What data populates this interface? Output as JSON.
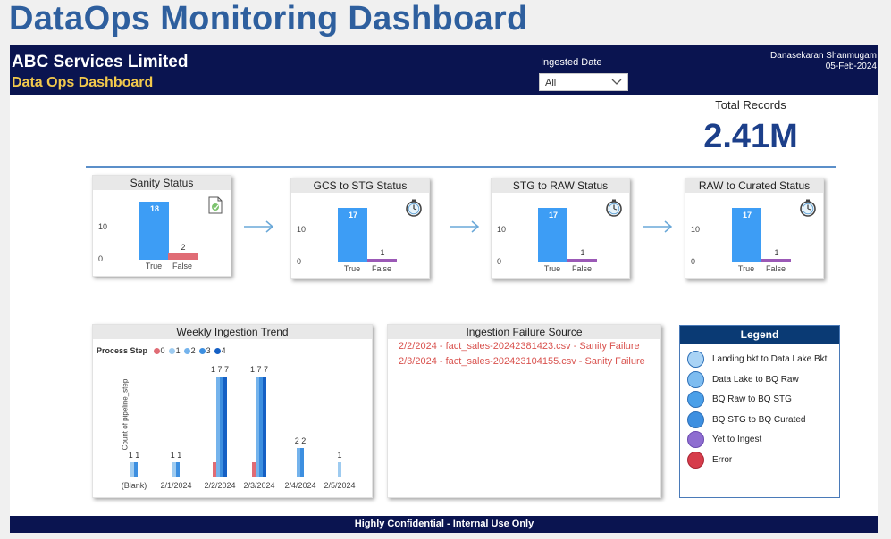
{
  "page_title": "DataOps Monitoring Dashboard",
  "header": {
    "company": "ABC Services Limited",
    "subtitle": "Data Ops Dashboard",
    "filter_label": "Ingested Date",
    "filter_value": "All",
    "user": "Danasekaran Shanmugam",
    "date": "05-Feb-2024"
  },
  "kpi": {
    "label": "Total Records",
    "value": "2.41M"
  },
  "status_cards": [
    {
      "title": "Sanity Status",
      "icon": "document-icon",
      "true_value": 18,
      "false_value": 2,
      "true_label": "True",
      "false_label": "False",
      "false_color": "#e06c75"
    },
    {
      "title": "GCS to STG Status",
      "icon": "stopwatch-icon",
      "true_value": 17,
      "false_value": 1,
      "true_label": "True",
      "false_label": "False",
      "false_color": "#9b59b6"
    },
    {
      "title": "STG to RAW Status",
      "icon": "stopwatch-icon",
      "true_value": 17,
      "false_value": 1,
      "true_label": "True",
      "false_label": "False",
      "false_color": "#9b59b6"
    },
    {
      "title": "RAW to Curated Status",
      "icon": "stopwatch-icon",
      "true_value": 17,
      "false_value": 1,
      "true_label": "True",
      "false_label": "False",
      "false_color": "#9b59b6"
    }
  ],
  "status_axis": {
    "ticks": [
      "10",
      "0"
    ]
  },
  "trend": {
    "title": "Weekly Ingestion Trend",
    "legend_title": "Process Step",
    "legend_items": [
      "0",
      "1",
      "2",
      "3",
      "4"
    ],
    "legend_colors": [
      "#e06c75",
      "#9ecbf0",
      "#74b3ec",
      "#3d8fe0",
      "#1560c4"
    ],
    "ylabel": "Count of pipeline_step",
    "categories": [
      "(Blank)",
      "2/1/2024",
      "2/2/2024",
      "2/3/2024",
      "2/4/2024",
      "2/5/2024"
    ],
    "bar_labels": [
      [
        "1",
        "1"
      ],
      [
        "1",
        "1"
      ],
      [
        "1",
        "7",
        "7"
      ],
      [
        "1",
        "7",
        "7"
      ],
      [
        "2",
        "2"
      ],
      [
        "1"
      ]
    ]
  },
  "chart_data": {
    "type": "bar",
    "title": "Weekly Ingestion Trend",
    "ylabel": "Count of pipeline_step",
    "categories": [
      "(Blank)",
      "2/1/2024",
      "2/2/2024",
      "2/3/2024",
      "2/4/2024",
      "2/5/2024"
    ],
    "series": [
      {
        "name": "0",
        "values": [
          0,
          0,
          1,
          1,
          0,
          0
        ]
      },
      {
        "name": "1",
        "values": [
          1,
          1,
          0,
          0,
          0,
          1
        ]
      },
      {
        "name": "2",
        "values": [
          0,
          0,
          7,
          7,
          2,
          0
        ]
      },
      {
        "name": "3",
        "values": [
          1,
          1,
          7,
          7,
          2,
          0
        ]
      },
      {
        "name": "4",
        "values": [
          0,
          0,
          7,
          7,
          0,
          0
        ]
      }
    ]
  },
  "failures": {
    "title": "Ingestion Failure Source",
    "items": [
      "2/2/2024 - fact_sales-20242381423.csv - Sanity Failure",
      "2/3/2024 - fact_sales-202423104155.csv - Sanity Failure"
    ]
  },
  "legend": {
    "title": "Legend",
    "items": [
      {
        "label": "Landing bkt to Data Lake Bkt",
        "color": "#a9d3f5"
      },
      {
        "label": "Data Lake to BQ Raw",
        "color": "#7dbcf0"
      },
      {
        "label": "BQ Raw to BQ STG",
        "color": "#4a9fe8"
      },
      {
        "label": "BQ STG to BQ Curated",
        "color": "#3d8fe0"
      },
      {
        "label": "Yet to Ingest",
        "color": "#8e6dd0"
      },
      {
        "label": "Error",
        "color": "#d63c4b"
      }
    ]
  },
  "footer": "Highly Confidential - Internal Use Only"
}
